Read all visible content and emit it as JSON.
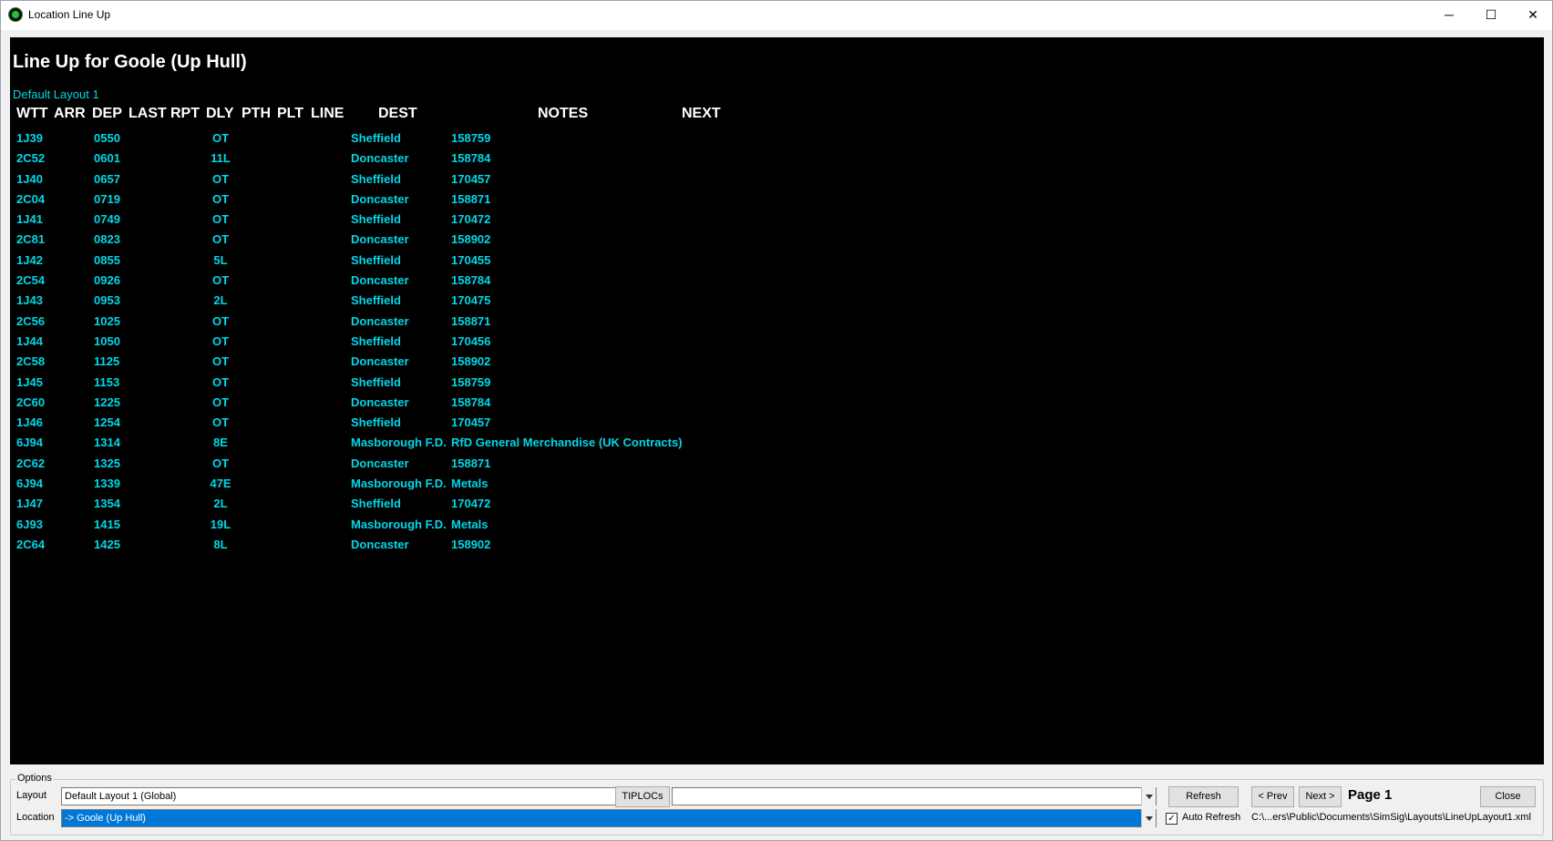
{
  "window": {
    "title": "Location Line Up",
    "minimize_glyph": "─",
    "maximize_glyph": "☐",
    "close_glyph": "✕"
  },
  "lineup": {
    "title": "Line Up for Goole (Up Hull)",
    "layout_name": "Default Layout 1",
    "columns": [
      "WTT",
      "ARR",
      "DEP",
      "LAST",
      "RPT",
      "DLY",
      "PTH",
      "PLT",
      "LINE",
      "DEST",
      "NOTES",
      "NEXT"
    ],
    "rows": [
      {
        "wtt": "1J39",
        "dep": "0550",
        "dly": "OT",
        "dest": "Sheffield",
        "notes": "158759"
      },
      {
        "wtt": "2C52",
        "dep": "0601",
        "dly": "11L",
        "dest": "Doncaster",
        "notes": "158784"
      },
      {
        "wtt": "1J40",
        "dep": "0657",
        "dly": "OT",
        "dest": "Sheffield",
        "notes": "170457"
      },
      {
        "wtt": "2C04",
        "dep": "0719",
        "dly": "OT",
        "dest": "Doncaster",
        "notes": "158871"
      },
      {
        "wtt": "1J41",
        "dep": "0749",
        "dly": "OT",
        "dest": "Sheffield",
        "notes": "170472"
      },
      {
        "wtt": "2C81",
        "dep": "0823",
        "dly": "OT",
        "dest": "Doncaster",
        "notes": "158902"
      },
      {
        "wtt": "1J42",
        "dep": "0855",
        "dly": "5L",
        "dest": "Sheffield",
        "notes": "170455"
      },
      {
        "wtt": "2C54",
        "dep": "0926",
        "dly": "OT",
        "dest": "Doncaster",
        "notes": "158784"
      },
      {
        "wtt": "1J43",
        "dep": "0953",
        "dly": "2L",
        "dest": "Sheffield",
        "notes": "170475"
      },
      {
        "wtt": "2C56",
        "dep": "1025",
        "dly": "OT",
        "dest": "Doncaster",
        "notes": "158871"
      },
      {
        "wtt": "1J44",
        "dep": "1050",
        "dly": "OT",
        "dest": "Sheffield",
        "notes": "170456"
      },
      {
        "wtt": "2C58",
        "dep": "1125",
        "dly": "OT",
        "dest": "Doncaster",
        "notes": "158902"
      },
      {
        "wtt": "1J45",
        "dep": "1153",
        "dly": "OT",
        "dest": "Sheffield",
        "notes": "158759"
      },
      {
        "wtt": "2C60",
        "dep": "1225",
        "dly": "OT",
        "dest": "Doncaster",
        "notes": "158784"
      },
      {
        "wtt": "1J46",
        "dep": "1254",
        "dly": "OT",
        "dest": "Sheffield",
        "notes": "170457"
      },
      {
        "wtt": "6J94",
        "dep": "1314",
        "dly": "8E",
        "dest": "Masborough F.D.",
        "notes": "RfD General Merchandise (UK Contracts)"
      },
      {
        "wtt": "2C62",
        "dep": "1325",
        "dly": "OT",
        "dest": "Doncaster",
        "notes": "158871"
      },
      {
        "wtt": "6J94",
        "dep": "1339",
        "dly": "47E",
        "dest": "Masborough F.D.",
        "notes": "Metals"
      },
      {
        "wtt": "1J47",
        "dep": "1354",
        "dly": "2L",
        "dest": "Sheffield",
        "notes": "170472"
      },
      {
        "wtt": "6J93",
        "dep": "1415",
        "dly": "19L",
        "dest": "Masborough F.D.",
        "notes": "Metals"
      },
      {
        "wtt": "2C64",
        "dep": "1425",
        "dly": "8L",
        "dest": "Doncaster",
        "notes": "158902"
      }
    ]
  },
  "options": {
    "legend": "Options",
    "layout_label": "Layout",
    "layout_value": "Default Layout 1 (Global)",
    "tiplocs_button": "TIPLOCs",
    "tiplocs_value": "",
    "location_label": "Location",
    "location_value": "-> Goole (Up Hull)",
    "refresh_button": "Refresh",
    "prev_button": "< Prev",
    "next_button": "Next >",
    "page_label": "Page 1",
    "close_button": "Close",
    "auto_refresh_label": "Auto Refresh",
    "auto_refresh_checked": true,
    "file_path": "C:\\...ers\\Public\\Documents\\SimSig\\Layouts\\LineUpLayout1.xml"
  },
  "colors": {
    "screen_bg": "#000000",
    "data_text": "#00d8e8",
    "header_text": "#ffffff",
    "selection": "#0078d7"
  }
}
